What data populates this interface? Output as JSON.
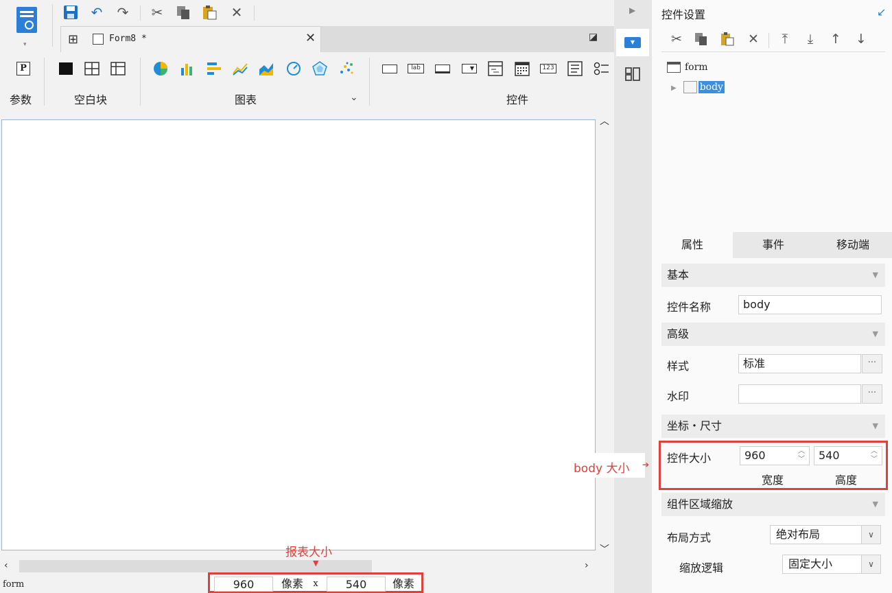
{
  "toolbar": {
    "quick_access": [
      "save-icon",
      "undo-icon",
      "redo-icon",
      "cut-icon",
      "copy-icon",
      "paste-icon",
      "delete-icon"
    ]
  },
  "tabs": {
    "active_label": "Form8 *"
  },
  "ribbon": {
    "params_label": "参数",
    "blank_block_label": "空白块",
    "chart_label": "图表",
    "widget_label": "控件",
    "lab_icon_text": "lab",
    "num_icon_text": "123"
  },
  "status": {
    "form_label": "form",
    "width_value": "960",
    "height_value": "540",
    "unit1": "像素",
    "unit2": "像素",
    "times": "x"
  },
  "callouts": {
    "report_size": "报表大小",
    "body_size": "body 大小"
  },
  "panel": {
    "title": "控件设置",
    "tree": {
      "root": "form",
      "child": "body"
    },
    "tabs": [
      "属性",
      "事件",
      "移动端"
    ],
    "sections": {
      "basic": "基本",
      "advanced": "高级",
      "coord": "坐标・尺寸",
      "zoom": "组件区域缩放"
    },
    "name_label": "控件名称",
    "name_value": "body",
    "style_label": "样式",
    "style_value": "标准",
    "watermark_label": "水印",
    "watermark_value": "",
    "size_label": "控件大小",
    "width_value": "960",
    "height_value": "540",
    "width_caption": "宽度",
    "height_caption": "高度",
    "layout_label": "布局方式",
    "layout_value": "绝对布局",
    "scale_label": "缩放逻辑",
    "scale_value": "固定大小",
    "ellipsis": "···"
  }
}
